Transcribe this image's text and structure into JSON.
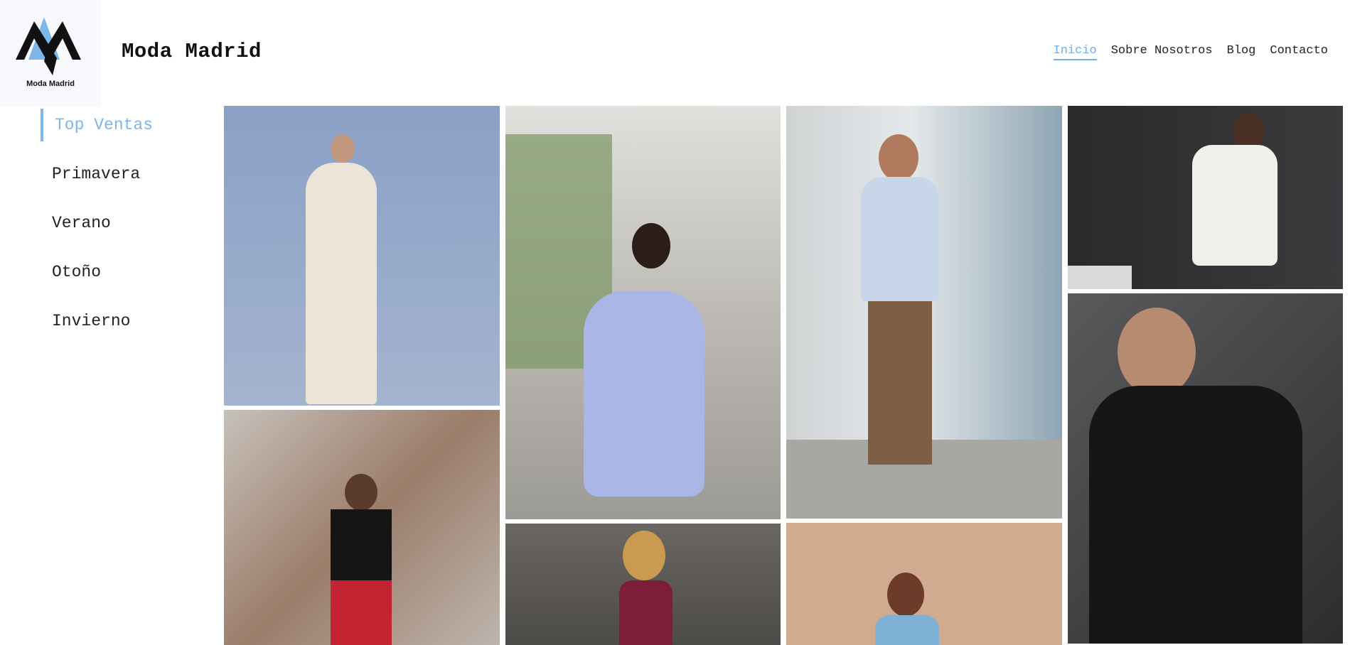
{
  "brand": {
    "logo_text": "Moda Madrid",
    "site_title": "Moda Madrid",
    "accent_color": "#7db6e8"
  },
  "top_nav": {
    "items": [
      {
        "label": "Inicio",
        "active": true
      },
      {
        "label": "Sobre Nosotros",
        "active": false
      },
      {
        "label": "Blog",
        "active": false
      },
      {
        "label": "Contacto",
        "active": false
      }
    ]
  },
  "sidebar": {
    "items": [
      {
        "label": "Top Ventas",
        "active": true
      },
      {
        "label": "Primavera",
        "active": false
      },
      {
        "label": "Verano",
        "active": false
      },
      {
        "label": "Otoño",
        "active": false
      },
      {
        "label": "Invierno",
        "active": false
      }
    ]
  },
  "gallery": {
    "photos": [
      {
        "name": "woman-floral-dress-sky",
        "bg": "#7e98c0"
      },
      {
        "name": "woman-lilac-dress-street",
        "bg": "#c9c8c4"
      },
      {
        "name": "man-blue-shirt-railing",
        "bg": "#b7bcc0"
      },
      {
        "name": "woman-white-knit-dress",
        "bg": "#2c2c2e"
      },
      {
        "name": "woman-black-top-stairs",
        "bg": "#9a8f86"
      },
      {
        "name": "man-leather-jacket",
        "bg": "#3a3a3c"
      },
      {
        "name": "woman-strapless-dress-stone",
        "bg": "#5d5a55"
      },
      {
        "name": "woman-sunglasses-beige",
        "bg": "#cba78c"
      }
    ]
  }
}
